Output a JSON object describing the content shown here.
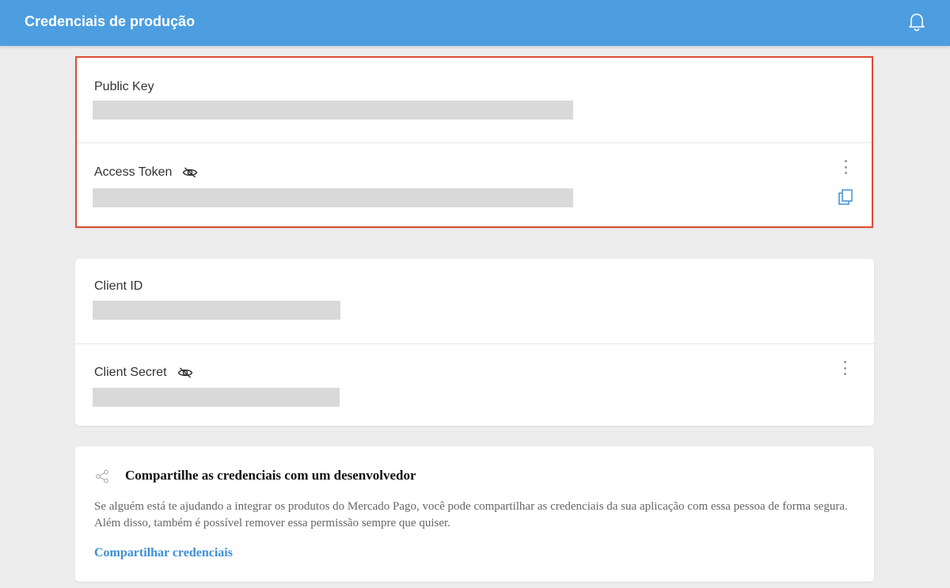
{
  "header": {
    "title": "Credenciais de produção",
    "bell_icon": "bell-icon"
  },
  "production_card": {
    "public_key": {
      "label": "Public Key"
    },
    "access_token": {
      "label": "Access Token",
      "visibility_icon": "eye-off-icon",
      "menu_icon": "kebab-menu-icon",
      "copy_icon": "copy-icon"
    }
  },
  "client_card": {
    "client_id": {
      "label": "Client ID"
    },
    "client_secret": {
      "label": "Client Secret",
      "visibility_icon": "eye-off-icon",
      "menu_icon": "kebab-menu-icon"
    }
  },
  "share_card": {
    "icon": "share-icon",
    "title": "Compartilhe as credenciais com um desenvolvedor",
    "description": "Se alguém está te ajudando a integrar os produtos do Mercado Pago, você pode compartilhar as credenciais da sua aplicação com essa pessoa de forma segura. Além disso, também é possível remover essa permissão sempre que quiser.",
    "link": "Compartilhar credenciais"
  },
  "colors": {
    "header": "#4c9ee0",
    "highlight_border": "#e04c35",
    "link": "#3d8fd6",
    "mask": "#d9d9d9"
  }
}
